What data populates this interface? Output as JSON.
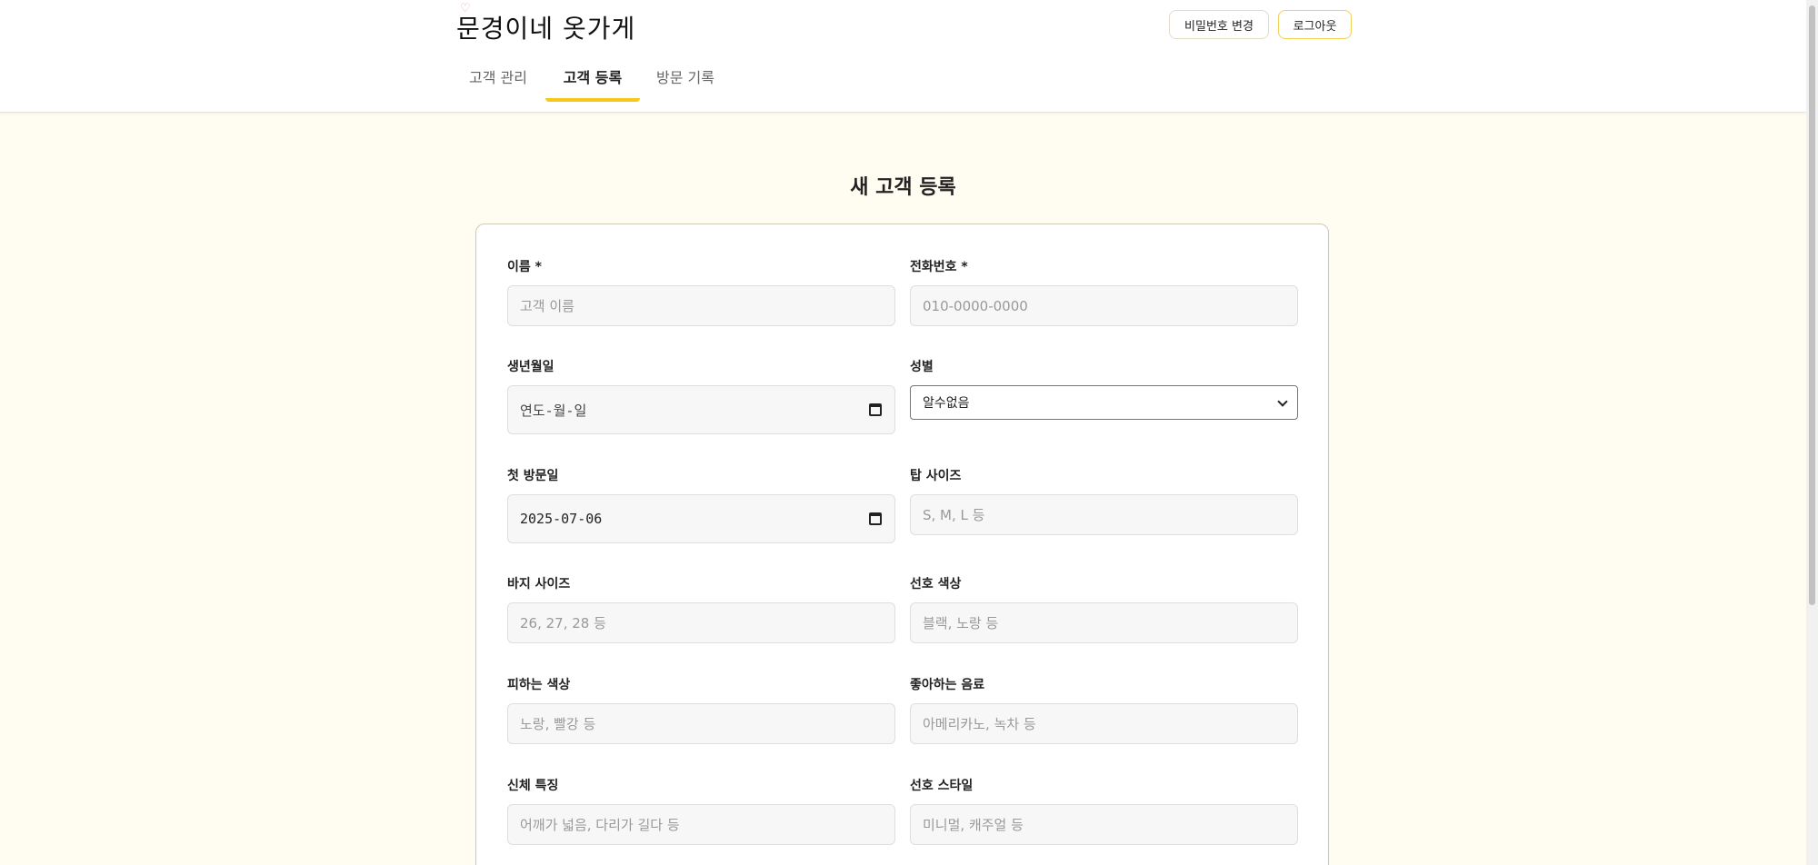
{
  "header": {
    "logo_text": "문경이네 옷가게",
    "logo_heart": "♡",
    "change_password_label": "비밀번호 변경",
    "logout_label": "로그아웃",
    "tabs": [
      {
        "label": "고객 관리",
        "active": false
      },
      {
        "label": "고객 등록",
        "active": true
      },
      {
        "label": "방문 기록",
        "active": false
      }
    ]
  },
  "form": {
    "title": "새 고객 등록",
    "fields": {
      "name": {
        "label": "이름 *",
        "placeholder": "고객 이름"
      },
      "phone": {
        "label": "전화번호 *",
        "placeholder": "010-0000-0000"
      },
      "birthdate": {
        "label": "생년월일",
        "display": "연도-월-일"
      },
      "gender": {
        "label": "성별",
        "selected": "알수없음"
      },
      "first_visit": {
        "label": "첫 방문일",
        "value": "2025-07-06"
      },
      "top_size": {
        "label": "탑 사이즈",
        "placeholder": "S, M, L 등"
      },
      "pants_size": {
        "label": "바지 사이즈",
        "placeholder": "26, 27, 28 등"
      },
      "preferred_color": {
        "label": "선호 색상",
        "placeholder": "블랙, 노랑 등"
      },
      "avoided_color": {
        "label": "피하는 색상",
        "placeholder": "노랑, 빨강 등"
      },
      "favorite_drink": {
        "label": "좋아하는 음료",
        "placeholder": "아메리카노, 녹차 등"
      },
      "body_features": {
        "label": "신체 특징",
        "placeholder": "어깨가 넓음, 다리가 길다 등"
      },
      "preferred_style": {
        "label": "선호 스타일",
        "placeholder": "미니멀, 캐주얼 등"
      }
    }
  },
  "colors": {
    "accent": "#f6c81c",
    "background": "#fffcf1"
  }
}
